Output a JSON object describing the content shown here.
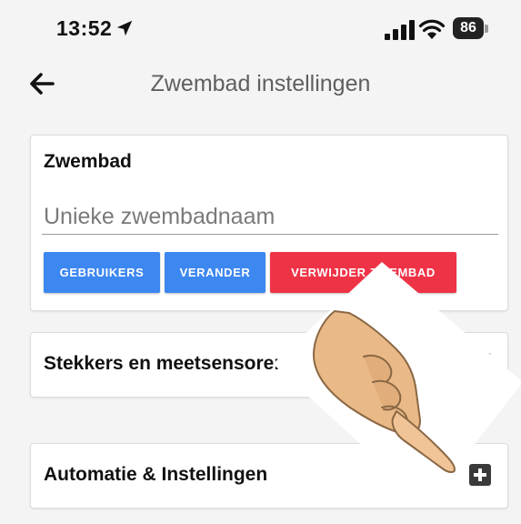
{
  "status_bar": {
    "time": "13:52",
    "battery": "86"
  },
  "nav": {
    "title": "Zwembad instellingen"
  },
  "pool_card": {
    "heading": "Zwembad",
    "name_placeholder": "Unieke zwembadnaam",
    "buttons": {
      "users": "GEBRUIKERS",
      "change": "VERANDER",
      "delete": "VERWIJDER ZWEMBAD"
    }
  },
  "sections": [
    {
      "heading": "Stekkers en meetsensoren"
    },
    {
      "heading": "Automatie & Instellingen"
    }
  ],
  "colors": {
    "primary": "#3d87f1",
    "danger": "#ef3347",
    "background": "#f4f4f5"
  },
  "icons": [
    "location-arrow-icon",
    "signal-icon",
    "wifi-icon",
    "battery-icon",
    "back-arrow-icon",
    "plus-square-icon",
    "pointing-hand-icon"
  ]
}
